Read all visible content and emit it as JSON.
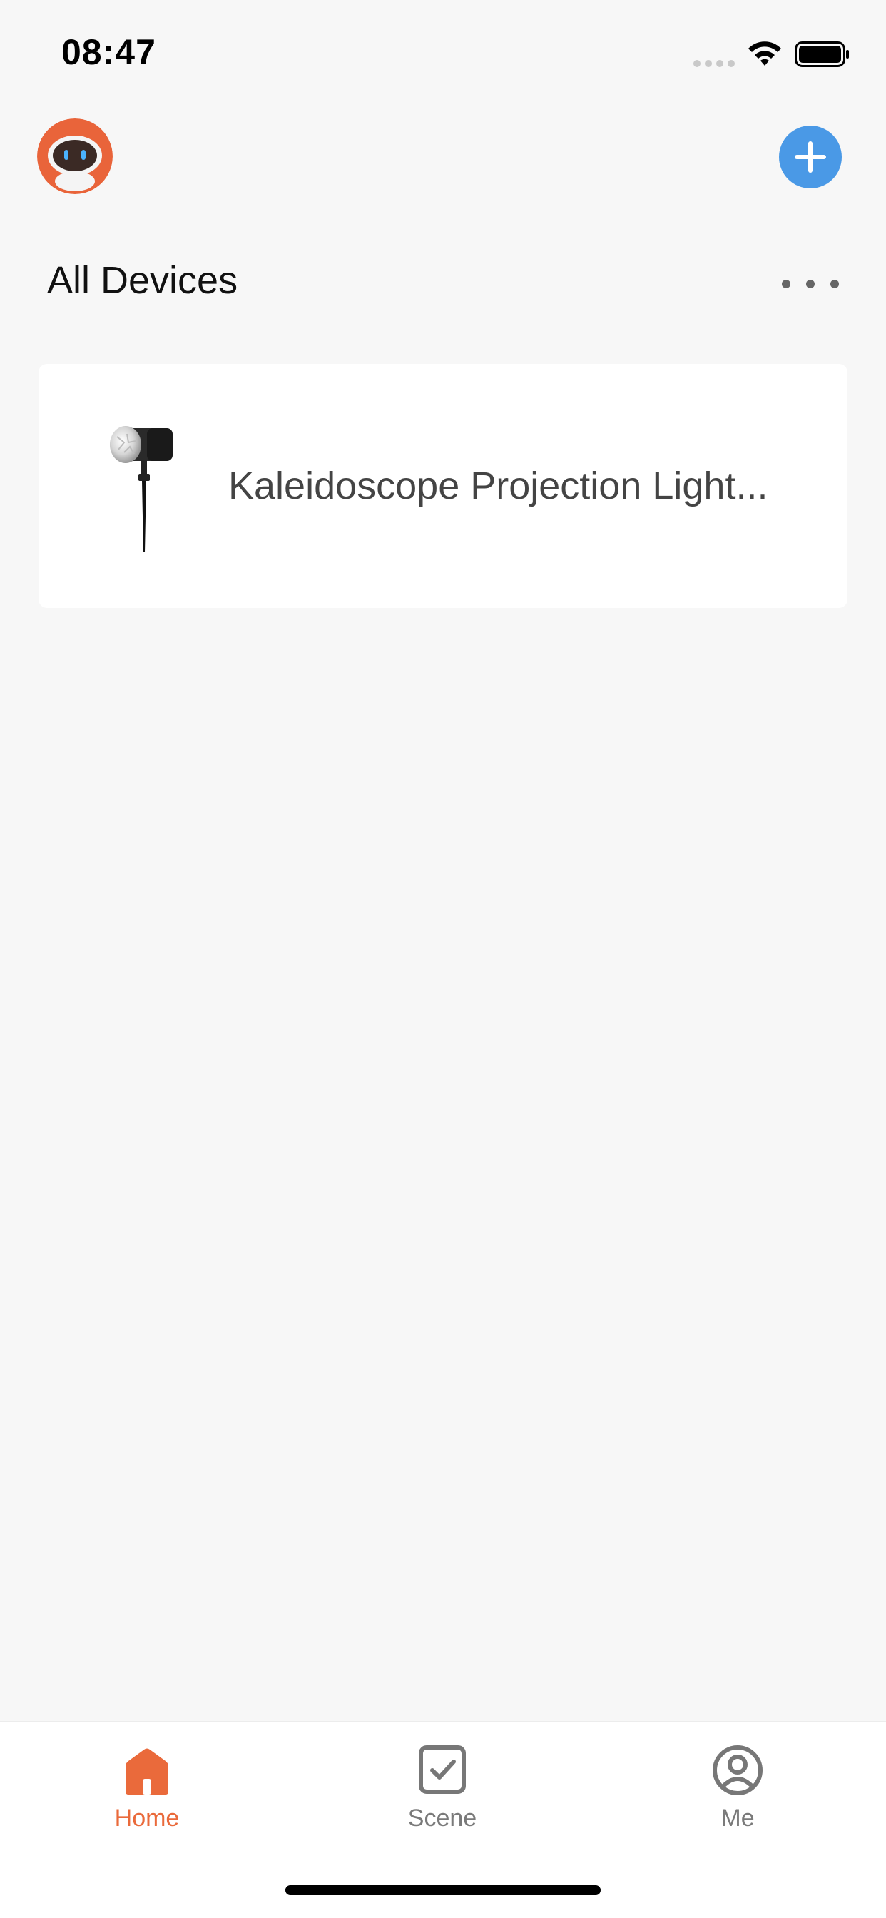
{
  "status_bar": {
    "time": "08:47",
    "wifi_icon": "wifi-icon",
    "battery_icon": "battery-icon"
  },
  "header": {
    "avatar_icon": "robot-avatar-icon",
    "add_icon": "plus-icon"
  },
  "section": {
    "title": "All Devices",
    "more_icon": "ellipsis-icon"
  },
  "devices": [
    {
      "name": "Kaleidoscope Projection Light...",
      "icon": "projection-light-icon"
    }
  ],
  "tabs": [
    {
      "label": "Home",
      "icon": "home-icon",
      "active": true
    },
    {
      "label": "Scene",
      "icon": "scene-checkbox-icon",
      "active": false
    },
    {
      "label": "Me",
      "icon": "profile-icon",
      "active": false
    }
  ],
  "colors": {
    "accent": "#ea6a3b",
    "add_button": "#4a99e6",
    "background": "#f7f7f7"
  }
}
